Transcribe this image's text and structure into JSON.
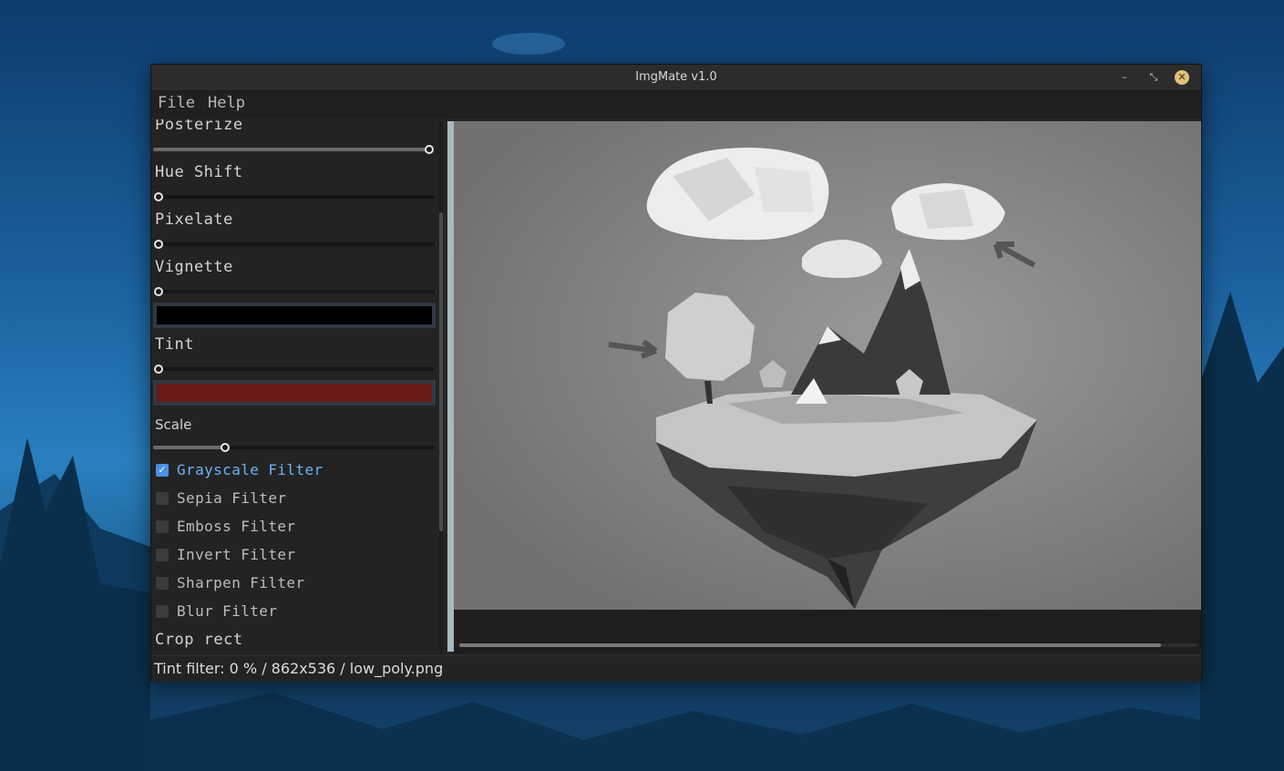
{
  "window": {
    "title": "ImgMate v1.0"
  },
  "titlebar": {
    "minimize_glyph": "–",
    "restore_glyph": "⤡",
    "close_glyph": "✕"
  },
  "menu": {
    "items": [
      "File",
      "Help"
    ]
  },
  "sliders": {
    "posterize": {
      "label": "Posterize",
      "value": 1.0
    },
    "hue_shift": {
      "label": "Hue Shift",
      "value": 0.0
    },
    "pixelate": {
      "label": "Pixelate",
      "value": 0.0
    },
    "vignette": {
      "label": "Vignette",
      "value": 0.0,
      "color": "#000000"
    },
    "tint": {
      "label": "Tint",
      "value": 0.0,
      "color": "#6b1a1a"
    },
    "scale": {
      "label": "Scale",
      "value": 0.25
    }
  },
  "filters": [
    {
      "label": "Grayscale Filter",
      "checked": true,
      "check_glyph": "✓"
    },
    {
      "label": "Sepia Filter",
      "checked": false
    },
    {
      "label": "Emboss Filter",
      "checked": false
    },
    {
      "label": "Invert Filter",
      "checked": false
    },
    {
      "label": "Sharpen Filter",
      "checked": false
    },
    {
      "label": "Blur Filter",
      "checked": false
    }
  ],
  "crop": {
    "label": "Crop rect"
  },
  "status": {
    "text": "Tint filter: 0 % / 862x536 / low_poly.png"
  },
  "colors": {
    "accent": "#4a90e2",
    "close_button": "#e0c07a",
    "divider": "#a9b8c2"
  }
}
